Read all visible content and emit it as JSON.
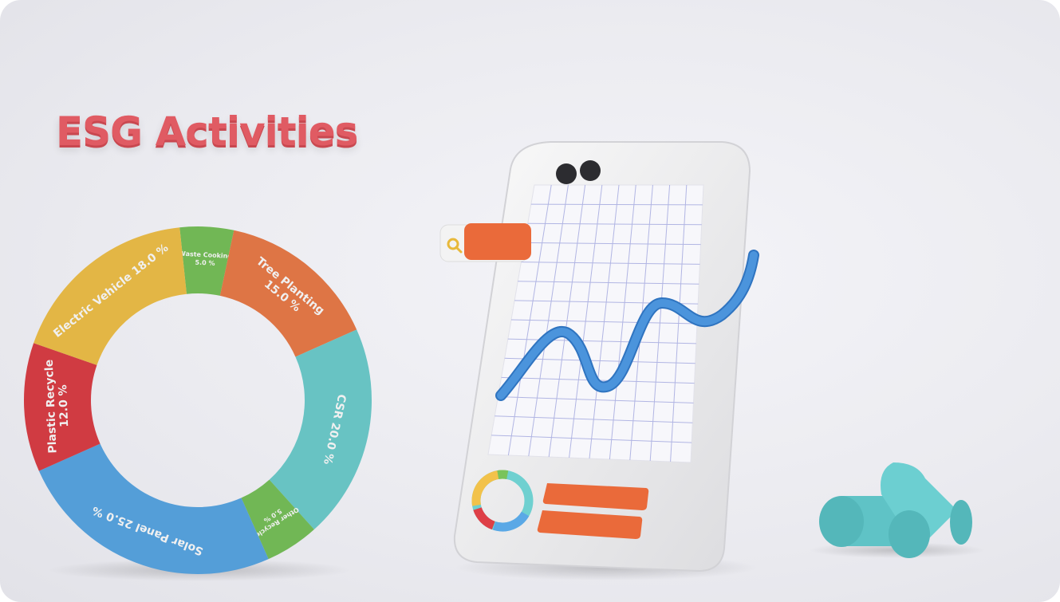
{
  "title": "ESG Activities",
  "chart_data": {
    "type": "pie",
    "slices": [
      {
        "label": "Waste Cooking",
        "value": 5.0,
        "text": "5.0 %",
        "color": "#79c35b"
      },
      {
        "label": "Tree Planting",
        "value": 15.0,
        "text": "15.0 %",
        "color": "#ec7d4a"
      },
      {
        "label": "CSR",
        "value": 20.0,
        "text": "20.0 %",
        "color": "#6fd0d0"
      },
      {
        "label": "Other Recycle",
        "value": 5.0,
        "text": "5.0 %",
        "color": "#79c35b"
      },
      {
        "label": "Solar Panel",
        "value": 25.0,
        "text": "25.0 %",
        "color": "#5aa8e6"
      },
      {
        "label": "Plastic Recycle",
        "value": 12.0,
        "text": "12.0 %",
        "color": "#de3f47"
      },
      {
        "label": "Electric Vehicle",
        "value": 18.0,
        "text": "18.0 %",
        "color": "#f2c24a"
      }
    ]
  },
  "colors": {
    "title": "#e05b63",
    "line": "#4b94dc",
    "bar": "#ea6a3a",
    "teal_shape": "#5fc3c6"
  },
  "icons": [
    "search-icon",
    "camera-lens-icon"
  ]
}
